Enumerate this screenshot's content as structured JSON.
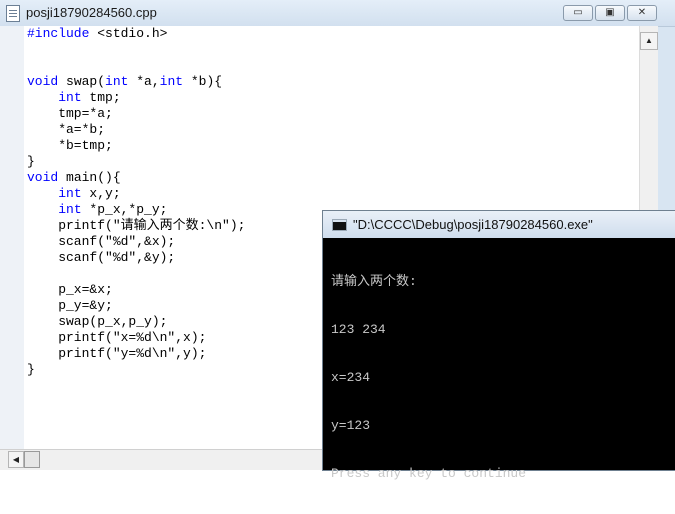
{
  "editor": {
    "title": "posji18790284560.cpp",
    "keyword_color": "#0000ff",
    "code_lines": [
      "#include <stdio.h>",
      "",
      "",
      "void swap(int *a,int *b){",
      "    int tmp;",
      "    tmp=*a;",
      "    *a=*b;",
      "    *b=tmp;",
      "}",
      "void main(){",
      "    int x,y;",
      "    int *p_x,*p_y;",
      "    printf(\"请输入两个数:\\n\");",
      "    scanf(\"%d\",&x);",
      "    scanf(\"%d\",&y);",
      "",
      "    p_x=&x;",
      "    p_y=&y;",
      "    swap(p_x,p_y);",
      "    printf(\"x=%d\\n\",x);",
      "    printf(\"y=%d\\n\",y);",
      "}"
    ],
    "window_buttons": {
      "minimize": "▭",
      "maximize": "▣",
      "close": "✕"
    },
    "scroll_up_glyph": "▲",
    "scroll_left_glyph": "◀"
  },
  "console": {
    "title": "\"D:\\CCCC\\Debug\\posji18790284560.exe\"",
    "output_lines": [
      "请输入两个数:",
      "123 234",
      "x=234",
      "y=123",
      "Press any key to continue"
    ]
  }
}
